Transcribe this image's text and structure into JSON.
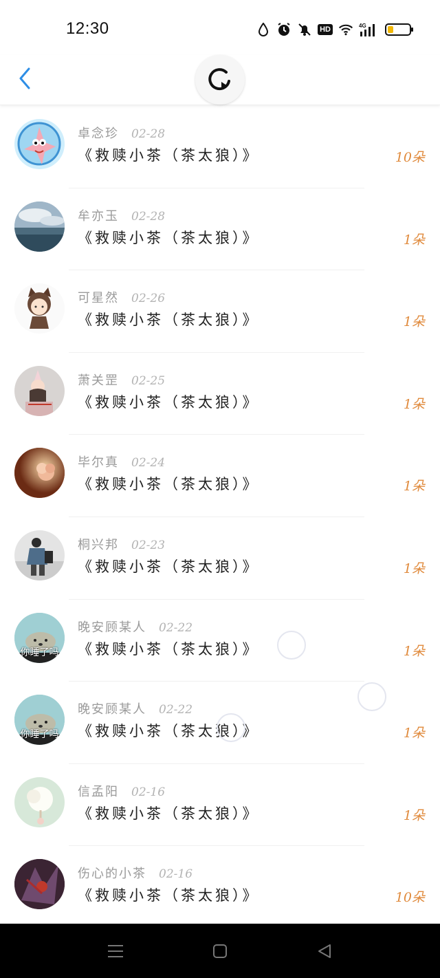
{
  "status_bar": {
    "time": "12:30",
    "icons": [
      "water-drop-icon",
      "alarm-icon",
      "mute-bell-icon",
      "hd-icon",
      "wifi-icon",
      "signal-4g-icon",
      "battery-icon"
    ],
    "hd_label": "HD",
    "network_label": "4G",
    "battery_level": 0.25,
    "battery_color": "#f2b705"
  },
  "header": {
    "back_icon": "chevron-left-icon",
    "refresh_icon": "refresh-icon",
    "accent": "#2e8ee6"
  },
  "list": {
    "items": [
      {
        "name": "卓念珍",
        "date": "02-28",
        "book": "《救赎小茶（茶太狼）》",
        "count": "10朵",
        "avatar": "patrick-star"
      },
      {
        "name": "牟亦玉",
        "date": "02-28",
        "book": "《救赎小茶（茶太狼）》",
        "count": "1朵",
        "avatar": "sea-sky"
      },
      {
        "name": "可星然",
        "date": "02-26",
        "book": "《救赎小茶（茶太狼）》",
        "count": "1朵",
        "avatar": "cat-girl"
      },
      {
        "name": "萧关罡",
        "date": "02-25",
        "book": "《救赎小茶（茶太狼）》",
        "count": "1朵",
        "avatar": "party-girl"
      },
      {
        "name": "毕尔真",
        "date": "02-24",
        "book": "《救赎小茶（茶太狼）》",
        "count": "1朵",
        "avatar": "flower"
      },
      {
        "name": "桐兴邦",
        "date": "02-23",
        "book": "《救赎小茶（茶太狼）》",
        "count": "1朵",
        "avatar": "person-bag"
      },
      {
        "name": "晚安顾某人",
        "date": "02-22",
        "book": "《救赎小茶（茶太狼）》",
        "count": "1朵",
        "avatar": "seal-sleepy",
        "avatar_text": "你睡了吗"
      },
      {
        "name": "晚安顾某人",
        "date": "02-22",
        "book": "《救赎小茶（茶太狼）》",
        "count": "1朵",
        "avatar": "seal-sleepy",
        "avatar_text": "你睡了吗"
      },
      {
        "name": "信孟阳",
        "date": "02-16",
        "book": "《救赎小茶（茶太狼）》",
        "count": "1朵",
        "avatar": "cotton-candy"
      },
      {
        "name": "伤心的小茶",
        "date": "02-16",
        "book": "《救赎小茶（茶太狼）》",
        "count": "10朵",
        "avatar": "dark-anime"
      }
    ],
    "count_color": "#e08a3c"
  },
  "nav_bar": {
    "icons": [
      "menu-icon",
      "home-square-icon",
      "back-triangle-icon"
    ]
  }
}
